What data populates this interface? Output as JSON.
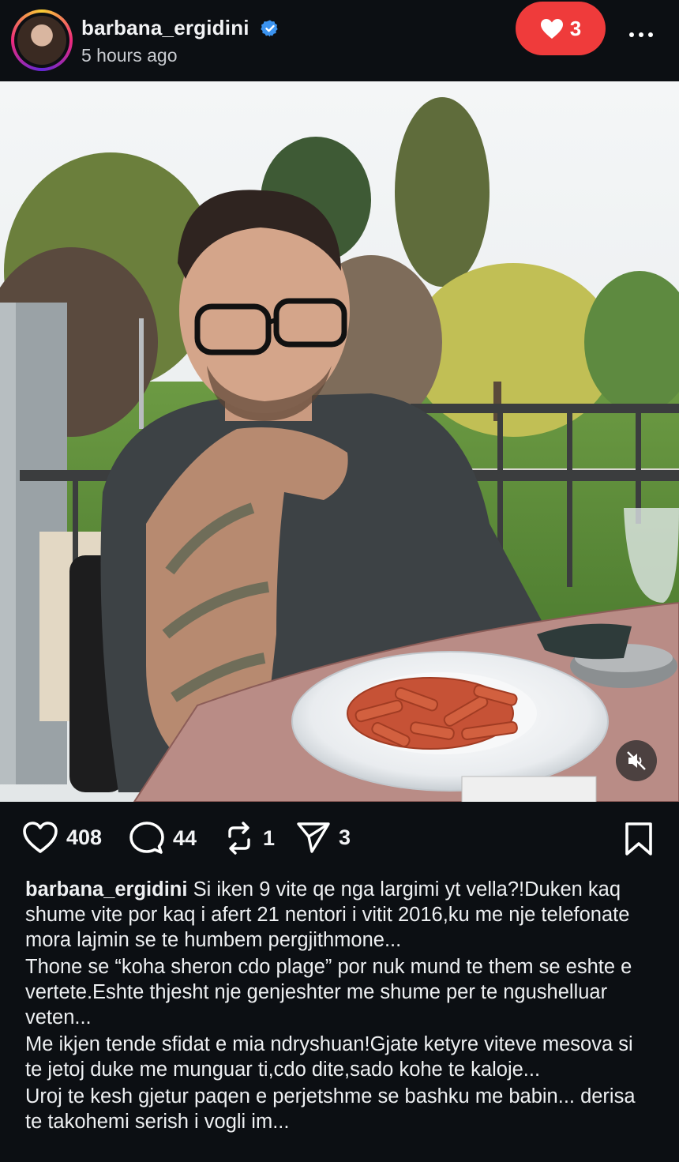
{
  "post": {
    "username": "barbana_ergidini",
    "time": "5 hours ago",
    "like_pill_count": "3",
    "verified_icon": "verified-badge-icon",
    "accent_like": "#ef3b3b",
    "accent_verified": "#3b93f0"
  },
  "actions": {
    "likes": "408",
    "comments": "44",
    "reposts": "1",
    "shares": "3"
  },
  "caption": {
    "username": "barbana_ergidini",
    "p1": "Si iken 9 vite qe nga largimi yt vella?!Duken kaq shume vite por kaq i afert 21 nentori i vitit 2016,ku me nje telefonate mora lajmin se te humbem pergjithmone...",
    "p2": "Thone se “koha sheron cdo plage” por nuk mund te them se eshte e vertete.Eshte thjesht nje genjeshter me shume per te ngushelluar veten...",
    "p3": "Me ikjen tende sfidat e mia ndryshuan!Gjate ketyre viteve mesova si te jetoj duke me munguar ti,cdo dite,sado kohe te kaloje...",
    "p4": "Uroj te kesh gjetur paqen e perjetshme se bashku me babin... derisa te takohemi serish i vogli im..."
  }
}
